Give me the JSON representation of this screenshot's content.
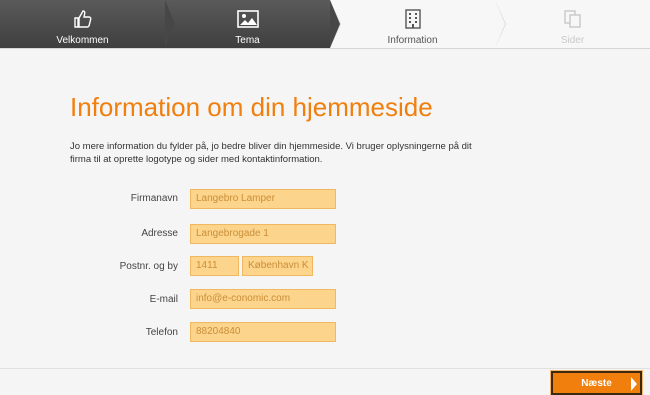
{
  "steps": [
    {
      "label": "Velkommen",
      "icon": "thumbs-up-icon",
      "state": "done"
    },
    {
      "label": "Tema",
      "icon": "image-icon",
      "state": "done"
    },
    {
      "label": "Information",
      "icon": "building-icon",
      "state": "current"
    },
    {
      "label": "Sider",
      "icon": "pages-icon",
      "state": "future"
    }
  ],
  "main": {
    "title": "Information om din hjemmeside",
    "intro": "Jo mere information du fylder på, jo bedre bliver din hjemmeside. Vi bruger oplysningerne på dit firma til at oprette logotype og sider med kontaktinformation."
  },
  "form": {
    "company_label": "Firmanavn",
    "company_value": "Langebro Lamper",
    "address_label": "Adresse",
    "address_value": "Langebrogade 1",
    "postal_label": "Postnr. og by",
    "postal_value": "1411",
    "city_value": "København K",
    "email_label": "E-mail",
    "email_value": "info@e-conomic.com",
    "phone_label": "Telefon",
    "phone_value": "88204840"
  },
  "footer": {
    "next_label": "Næste"
  },
  "colors": {
    "accent": "#f07f0e",
    "input_bg": "#fdd48b"
  }
}
